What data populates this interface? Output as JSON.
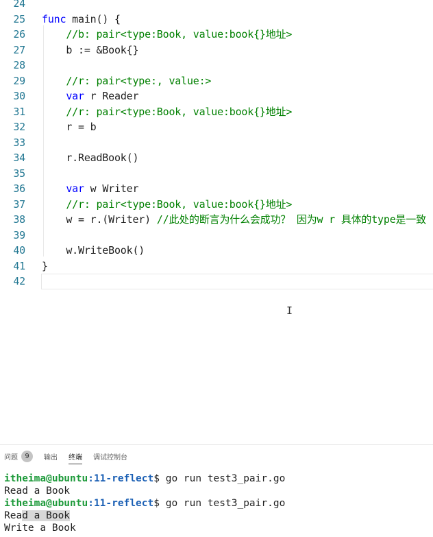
{
  "editor": {
    "lines": [
      {
        "num": "24",
        "tokens": []
      },
      {
        "num": "25",
        "tokens": [
          {
            "t": "func",
            "c": "kw"
          },
          {
            "t": " main() {",
            "c": "txt"
          }
        ]
      },
      {
        "num": "26",
        "tokens": [
          {
            "t": "    //b: pair<type:Book, value:book{}地址>",
            "c": "cm"
          }
        ]
      },
      {
        "num": "27",
        "tokens": [
          {
            "t": "    b := &Book{}",
            "c": "txt"
          }
        ]
      },
      {
        "num": "28",
        "tokens": []
      },
      {
        "num": "29",
        "tokens": [
          {
            "t": "    //r: pair<type:, value:>",
            "c": "cm"
          }
        ]
      },
      {
        "num": "30",
        "tokens": [
          {
            "t": "    ",
            "c": "txt"
          },
          {
            "t": "var",
            "c": "kw"
          },
          {
            "t": " r Reader",
            "c": "txt"
          }
        ]
      },
      {
        "num": "31",
        "tokens": [
          {
            "t": "    //r: pair<type:Book, value:book{}地址>",
            "c": "cm"
          }
        ]
      },
      {
        "num": "32",
        "tokens": [
          {
            "t": "    r = b",
            "c": "txt"
          }
        ]
      },
      {
        "num": "33",
        "tokens": []
      },
      {
        "num": "34",
        "tokens": [
          {
            "t": "    r.ReadBook()",
            "c": "txt"
          }
        ]
      },
      {
        "num": "35",
        "tokens": []
      },
      {
        "num": "36",
        "tokens": [
          {
            "t": "    ",
            "c": "txt"
          },
          {
            "t": "var",
            "c": "kw"
          },
          {
            "t": " w Writer",
            "c": "txt"
          }
        ]
      },
      {
        "num": "37",
        "tokens": [
          {
            "t": "    //r: pair<type:Book, value:book{}地址>",
            "c": "cm"
          }
        ]
      },
      {
        "num": "38",
        "tokens": [
          {
            "t": "    w = r.(Writer) ",
            "c": "txt"
          },
          {
            "t": "//此处的断言为什么会成功？ 因为w r 具体的type是一致",
            "c": "cm"
          }
        ]
      },
      {
        "num": "39",
        "tokens": []
      },
      {
        "num": "40",
        "tokens": [
          {
            "t": "    w.WriteBook()",
            "c": "txt"
          }
        ]
      },
      {
        "num": "41",
        "tokens": [
          {
            "t": "}",
            "c": "txt"
          }
        ]
      },
      {
        "num": "42",
        "tokens": []
      }
    ],
    "current_line": "42",
    "colors": {
      "keyword": "#0000ff",
      "comment": "#008000",
      "line_number": "#237893",
      "text": "#1f1f1f"
    }
  },
  "panel": {
    "tabs": [
      {
        "label": "问题",
        "badge": "9"
      },
      {
        "label": "输出"
      },
      {
        "label": "终端",
        "active": true
      },
      {
        "label": "调试控制台"
      }
    ]
  },
  "terminal": {
    "lines": [
      {
        "user": "itheima@ubuntu",
        "path": ":11-reflect",
        "rest": "$ go run test3_pair.go"
      },
      {
        "text": "Read a Book"
      },
      {
        "user": "itheima@ubuntu",
        "path": ":11-reflect",
        "rest": "$ go run test3_pair.go"
      },
      {
        "text": "Read a Book",
        "selected_from": 3
      },
      {
        "text": "Write a Book"
      }
    ],
    "colors": {
      "user": "#1d9a3a",
      "path": "#1a5fb4"
    }
  }
}
